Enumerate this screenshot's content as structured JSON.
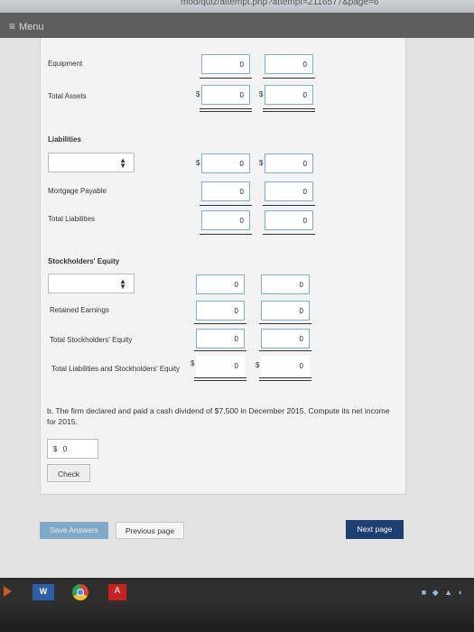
{
  "browser": {
    "url": "mod/quiz/attempt.php?attempt=2116577&page=6"
  },
  "topbar": {
    "menu_icon": "hamburger-icon",
    "menu_label": "Menu"
  },
  "balance_sheet": {
    "equipment": {
      "label": "Equipment",
      "v1": "0",
      "v2": "0"
    },
    "total_assets": {
      "label": "Total Assets",
      "dollar": "$",
      "v1": "0",
      "v2": "0"
    },
    "liabilities_heading": "Liabilities",
    "liab_select_row": {
      "dollar": "$",
      "v1": "0",
      "v2": "0"
    },
    "mortgage_payable": {
      "label": "Mortgage Payable",
      "v1": "0",
      "v2": "0"
    },
    "total_liabilities": {
      "label": "Total Liabilities",
      "v1": "0",
      "v2": "0"
    },
    "equity_heading": "Stockholders' Equity",
    "equity_select_row": {
      "v1": "0",
      "v2": "0"
    },
    "retained_earnings": {
      "label": "Retained Earnings",
      "v1": "0",
      "v2": "0"
    },
    "total_equity": {
      "label": "Total Stockholders' Equity",
      "v1": "0",
      "v2": "0"
    },
    "total_liab_equity": {
      "label": "Total Liabilities and Stockholders' Equity",
      "dollar": "$",
      "v1": "0",
      "v2": "0"
    }
  },
  "part_b": {
    "question": "b. The firm declared and paid a cash dividend of $7,500 in December 2015. Compute its net income for 2015.",
    "currency": "$",
    "value": "0",
    "check_label": "Check"
  },
  "nav": {
    "save_label": "Save Answers",
    "prev_label": "Previous page",
    "next_label": "Next page"
  },
  "taskbar": {
    "word_label": "W",
    "pdf_label": "A",
    "colors": {
      "accent": "#1e3f73",
      "save": "#7fa8c9",
      "input_border": "#7ab0d6"
    }
  }
}
